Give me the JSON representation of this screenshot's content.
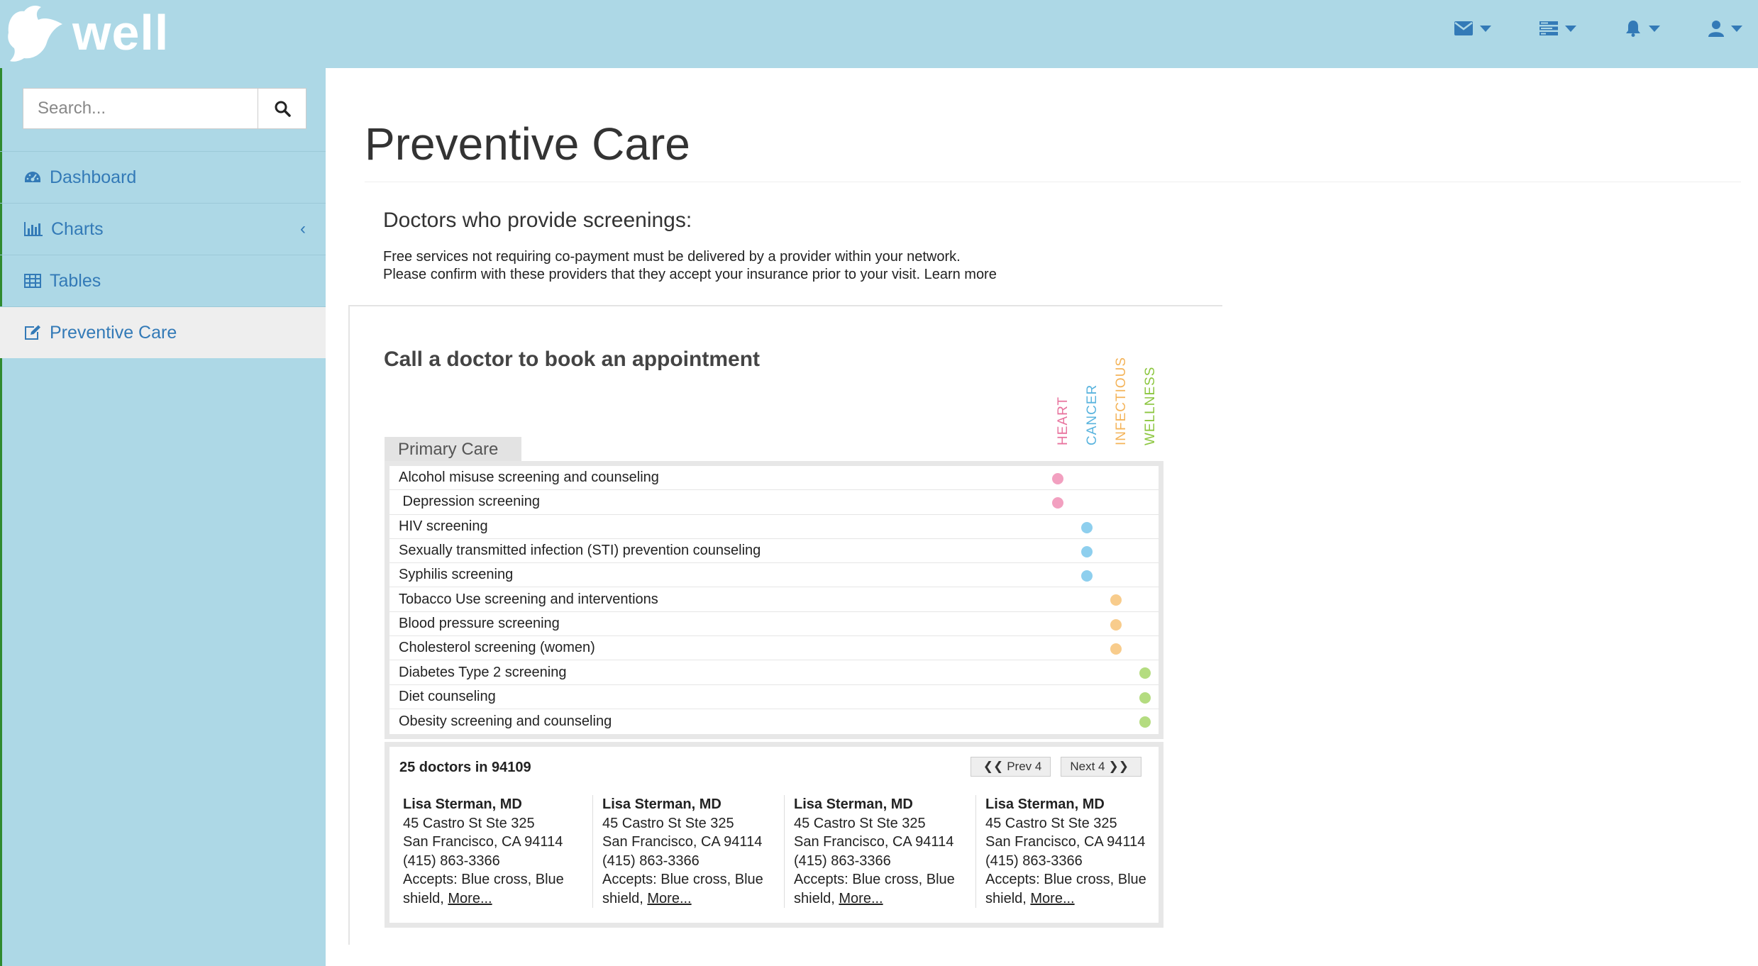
{
  "app": {
    "brand": "well"
  },
  "header": {
    "icons": [
      {
        "name": "envelope-icon",
        "color": "#337ab7"
      },
      {
        "name": "tasks-icon",
        "color": "#337ab7"
      },
      {
        "name": "bell-icon",
        "color": "#337ab7"
      },
      {
        "name": "user-icon",
        "color": "#337ab7"
      }
    ]
  },
  "sidebar": {
    "search": {
      "placeholder": "Search...",
      "value": ""
    },
    "items": [
      {
        "label": "Dashboard",
        "icon": "dashboard-icon"
      },
      {
        "label": "Charts",
        "icon": "bar-chart-icon",
        "chevron": "‹"
      },
      {
        "label": "Tables",
        "icon": "table-icon"
      },
      {
        "label": "Preventive Care",
        "icon": "edit-icon",
        "active": true
      }
    ]
  },
  "main": {
    "title": "Preventive Care",
    "section_title": "Doctors who provide screenings:",
    "intro_line1": "Free services not requiring co-payment must be delivered by a provider within your network.",
    "intro_line2": "Please confirm with these providers that they accept your insurance prior to your visit. Learn more",
    "card_title": "Call a doctor to book an appointment",
    "categories": [
      {
        "label": "HEART",
        "color": "#e8739e"
      },
      {
        "label": "CANCER",
        "color": "#5ab4de"
      },
      {
        "label": "INFECTIOUS",
        "color": "#f4b45a"
      },
      {
        "label": "WELLNESS",
        "color": "#8cc63f"
      }
    ],
    "tab_label": "Primary Care",
    "services": [
      {
        "label": "Alcohol misuse screening and counseling",
        "category": 0
      },
      {
        "label": " Depression screening",
        "category": 0
      },
      {
        "label": "HIV screening",
        "category": 1
      },
      {
        "label": "Sexually transmitted infection (STI) prevention counseling",
        "category": 1
      },
      {
        "label": "Syphilis screening",
        "category": 1
      },
      {
        "label": "Tobacco Use screening and interventions",
        "category": 2
      },
      {
        "label": "Blood pressure screening",
        "category": 2
      },
      {
        "label": "Cholesterol screening (women)",
        "category": 2
      },
      {
        "label": "Diabetes Type 2 screening",
        "category": 3
      },
      {
        "label": "Diet counseling",
        "category": 3
      },
      {
        "label": "Obesity screening and counseling",
        "category": 3
      }
    ],
    "dot_colors": [
      "#f2a0c0",
      "#8ecfee",
      "#f8cc8c",
      "#b4dc80"
    ],
    "doctors_count": "25 doctors in 94109",
    "prev_label": "Prev 4",
    "next_label": "Next 4",
    "doctors": [
      {
        "name": "Lisa Sterman, MD",
        "address": "45 Castro St Ste 325",
        "city": "San Francisco, CA 94114",
        "phone": "(415) 863-3366",
        "accepts": "Accepts: Blue cross, Blue shield,",
        "more": "More..."
      },
      {
        "name": "Lisa Sterman, MD",
        "address": "45 Castro St Ste 325",
        "city": "San Francisco, CA 94114",
        "phone": "(415) 863-3366",
        "accepts": "Accepts: Blue cross, Blue shield,",
        "more": "More..."
      },
      {
        "name": "Lisa Sterman, MD",
        "address": "45 Castro St Ste 325",
        "city": "San Francisco, CA 94114",
        "phone": "(415) 863-3366",
        "accepts": "Accepts: Blue cross, Blue shield,",
        "more": "More..."
      },
      {
        "name": "Lisa Sterman, MD",
        "address": "45 Castro St Ste 325",
        "city": "San Francisco, CA 94114",
        "phone": "(415) 863-3366",
        "accepts": "Accepts: Blue cross, Blue shield,",
        "more": "More..."
      }
    ]
  }
}
